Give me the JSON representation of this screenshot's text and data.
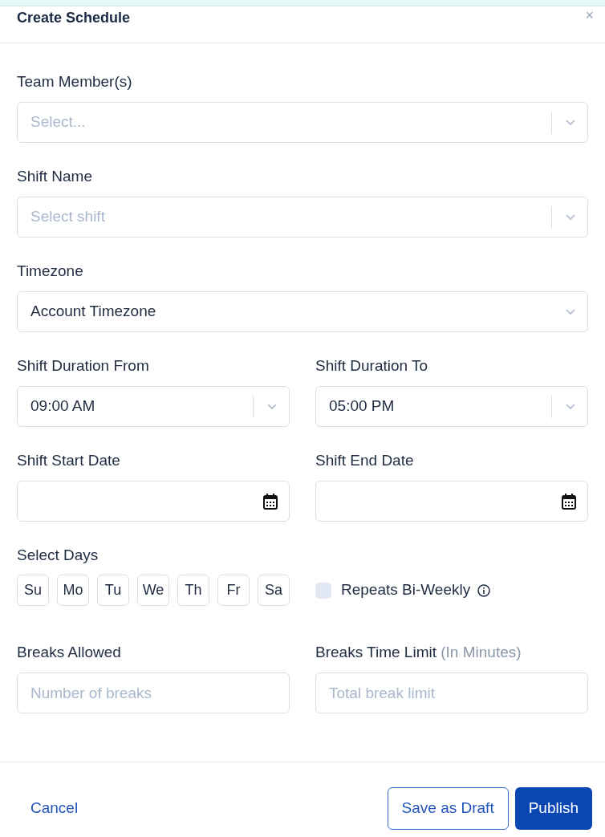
{
  "dialog": {
    "title": "Create Schedule",
    "close": "×"
  },
  "rows": [
    [
      {
        "label": "Team Member(s)",
        "kind": "select",
        "placeholder": "Select..."
      }
    ],
    [
      {
        "label": "Shift Name",
        "kind": "select",
        "placeholder": "Select shift"
      }
    ],
    [
      {
        "label": "Timezone",
        "kind": "dropdown",
        "value": "Account Timezone"
      }
    ],
    [
      {
        "label": "Shift Duration From",
        "kind": "select",
        "value": "09:00 AM"
      },
      {
        "label": "Shift Duration To",
        "kind": "select",
        "value": "05:00 PM"
      }
    ],
    [
      {
        "label": "Shift Start Date",
        "kind": "date"
      },
      {
        "label": "Shift End Date",
        "kind": "date"
      }
    ]
  ],
  "days": {
    "label": "Select Days",
    "items": [
      {
        "label": "Su",
        "selected": false
      },
      {
        "label": "Mo",
        "selected": false
      },
      {
        "label": "Tu",
        "selected": false
      },
      {
        "label": "We",
        "selected": false
      },
      {
        "label": "Th",
        "selected": false
      },
      {
        "label": "Fr",
        "selected": false
      },
      {
        "label": "Sa",
        "selected": false
      }
    ],
    "repeat": {
      "label": "Repeats Bi-Weekly",
      "checked": false
    }
  },
  "breaks": [
    {
      "label": "Breaks Allowed",
      "kind": "input",
      "placeholder": "Number of breaks"
    },
    {
      "label": "Breaks Time Limit",
      "note": "(In Minutes)",
      "kind": "input",
      "placeholder": "Total break limit"
    }
  ],
  "footer": {
    "cancel": "Cancel",
    "draft": "Save as Draft",
    "publish": "Publish"
  }
}
